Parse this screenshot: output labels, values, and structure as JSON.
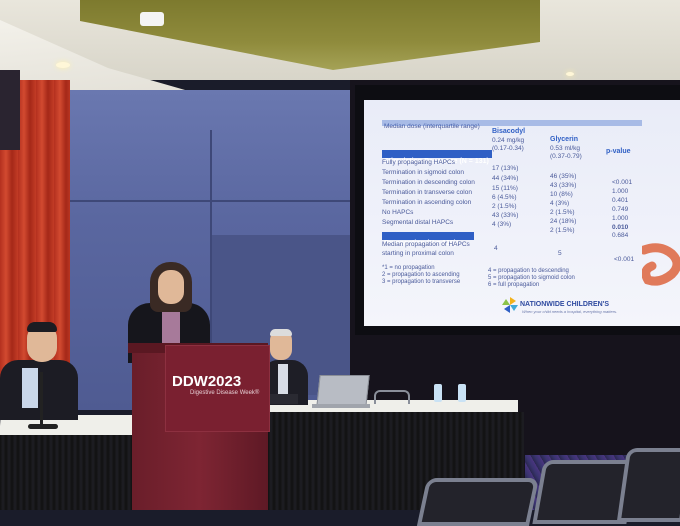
{
  "podium": {
    "logo_text": "DDW2023",
    "subtitle": "Digestive Disease Week®"
  },
  "slide": {
    "first_line": "Median dose (interquartile range)",
    "col_bisacodyl": "Bisacodyl",
    "col_glycerin": "Glycerin",
    "col_pvalue": "p-value",
    "dose_bisacodyl": "0.24 mg/kg",
    "dose_bisacodyl_iqr": "(0.17-0.34)",
    "dose_glycerin": "0.53 ml/kg",
    "dose_glycerin_iqr": "(0.37-0.79)",
    "stim_header": "Stimulation Response (N = 131)",
    "rows": [
      {
        "label": "Fully propagating HAPCs",
        "bis": "",
        "gly": "",
        "p": ""
      },
      {
        "label": "Termination in sigmoid colon",
        "bis": "17 (13%)",
        "gly": "46 (35%)",
        "p": "<0.001"
      },
      {
        "label": "Termination in descending colon",
        "bis": "44 (34%)",
        "gly": "43 (33%)",
        "p": "1.000"
      },
      {
        "label": "Termination in transverse colon",
        "bis": "15 (11%)",
        "gly": "10 (8%)",
        "p": "0.401"
      },
      {
        "label": "Termination in ascending colon",
        "bis": "6 (4.5%)",
        "gly": "4 (3%)",
        "p": "0.749"
      },
      {
        "label": "No HAPCs",
        "bis": "2 (1.5%)",
        "gly": "2 (1.5%)",
        "p": "1.000"
      },
      {
        "label": "Segmental distal HAPCs",
        "bis": "43 (33%)",
        "gly": "24 (18%)",
        "p": "0.010"
      },
      {
        "label": "",
        "bis": "4 (3%)",
        "gly": "2 (1.5%)",
        "p": "0.684"
      }
    ],
    "prop_header": "Propagation (N = 125)*",
    "prop_line1": "Median propagation of HAPCs",
    "prop_line2": "starting in proximal colon",
    "prop_bis": "4",
    "prop_gly": "5",
    "prop_p": "<0.001",
    "footnotes_left": [
      "*1 = no propagation",
      "2 = propagation to ascending",
      "3 = propagation to transverse"
    ],
    "footnotes_right": [
      "4 = propagation to descending",
      "5 = propagation to sigmoid colon",
      "6 = full propagation"
    ],
    "logo_text": "NATIONWIDE CHILDREN'S",
    "logo_tagline": "When your child needs a hospital, everything matters."
  },
  "colors": {
    "slide_accent": "#2f5fc5",
    "podium": "#7a2030",
    "curtain": "#c23c26",
    "wall": "#5a67a0"
  }
}
